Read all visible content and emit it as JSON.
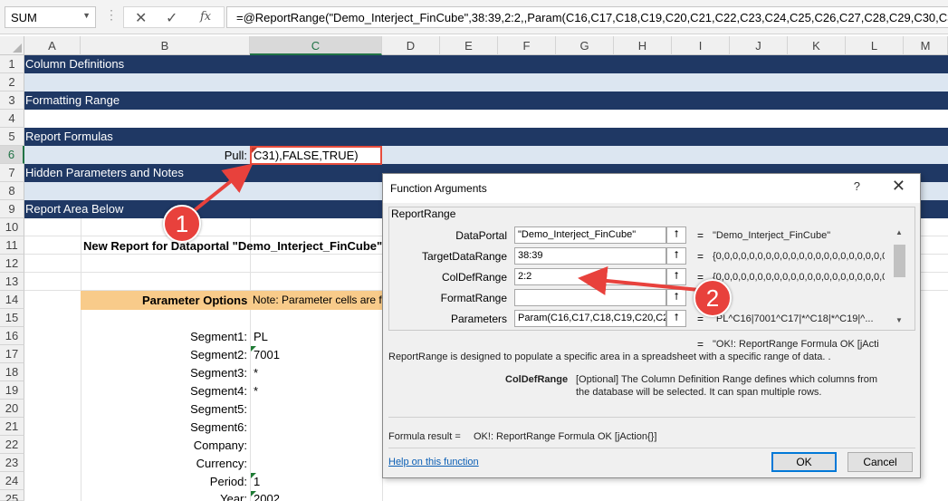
{
  "formula_bar": {
    "name_box": "SUM",
    "cancel_icon": "close-icon",
    "enter_icon": "check-icon",
    "fx_label": "fx",
    "formula_prefix": "=@ReportRange(\"Demo_Interject_FinCube\",38:39,2:2,,Param(",
    "formula_suffix": "C16,C17,C18,C19,C20,C21,C22,C23,C24,C25,C26,C27,C28,C29,C30,C3"
  },
  "columns": [
    "A",
    "B",
    "C",
    "D",
    "E",
    "F",
    "G",
    "H",
    "I",
    "J",
    "K",
    "L",
    "M"
  ],
  "rows": [
    "1",
    "2",
    "3",
    "4",
    "5",
    "6",
    "7",
    "8",
    "9",
    "10",
    "11",
    "12",
    "13",
    "14",
    "15",
    "16",
    "17",
    "18",
    "19",
    "20",
    "21",
    "22",
    "23",
    "24",
    "25"
  ],
  "sheet": {
    "row1": "Column Definitions",
    "row3": "Formatting Range",
    "row5": "Report Formulas",
    "row6_label": "Pull:",
    "row6_value": "C31),FALSE,TRUE)",
    "row7": "Hidden Parameters and Notes",
    "row9": "Report Area Below",
    "row11": "New Report for Dataportal \"Demo_Interject_FinCube\"",
    "row14_title": "Parameter Options",
    "row14_note": "Note: Parameter cells are f",
    "params": [
      {
        "label": "Segment1:",
        "value": "PL"
      },
      {
        "label": "Segment2:",
        "value": "7001"
      },
      {
        "label": "Segment3:",
        "value": "*"
      },
      {
        "label": "Segment4:",
        "value": "*"
      },
      {
        "label": "Segment5:",
        "value": ""
      },
      {
        "label": "Segment6:",
        "value": ""
      },
      {
        "label": "Company:",
        "value": ""
      },
      {
        "label": "Currency:",
        "value": ""
      },
      {
        "label": "Period:",
        "value": "1"
      },
      {
        "label": "Year:",
        "value": "2002"
      }
    ]
  },
  "dialog": {
    "title": "Function Arguments",
    "help": "?",
    "close": "✕",
    "function_name": "ReportRange",
    "args": [
      {
        "label": "DataPortal",
        "input": "\"Demo_Interject_FinCube\"",
        "result": "\"Demo_Interject_FinCube\""
      },
      {
        "label": "TargetDataRange",
        "input": "38:39",
        "result": "{0,0,0,0,0,0,0,0,0,0,0,0,0,0,0,0,0,0,0,0,0,0,0,0,0,0,0"
      },
      {
        "label": "ColDefRange",
        "input": "2:2",
        "result": "{0,0,0,0,0,0,0,0,0,0,0,0,0,0,0,0,0,0,0,0,0,0,0,0,0,0,0"
      },
      {
        "label": "FormatRange",
        "input": "",
        "result": ""
      },
      {
        "label": "Parameters",
        "input": "Param(C16,C17,C18,C19,C20,C21",
        "result": "\"PL^C16|7001^C17|*^C18|*^C19|^..."
      }
    ],
    "overall_result": "\"OK!: ReportRange Formula OK [jActi",
    "description": "ReportRange is designed to populate a specific area in a spreadsheet with a specific range of data. .",
    "arg_name": "ColDefRange",
    "arg_description_1": "[Optional] The Column Definition Range defines which columns from",
    "arg_description_2": "the database will be selected. It can span multiple rows.",
    "formula_result_label": "Formula result =",
    "formula_result_value": "OK!: ReportRange Formula OK [jAction{}]",
    "help_link": "Help on this function",
    "ok": "OK",
    "cancel": "Cancel"
  },
  "callouts": [
    "1",
    "2"
  ],
  "colors": {
    "header_band": "#1f3864",
    "light_band": "#dce6f1",
    "param_band": "#f8cb8a",
    "accent_red": "#e74c3c",
    "excel_green": "#217346"
  }
}
